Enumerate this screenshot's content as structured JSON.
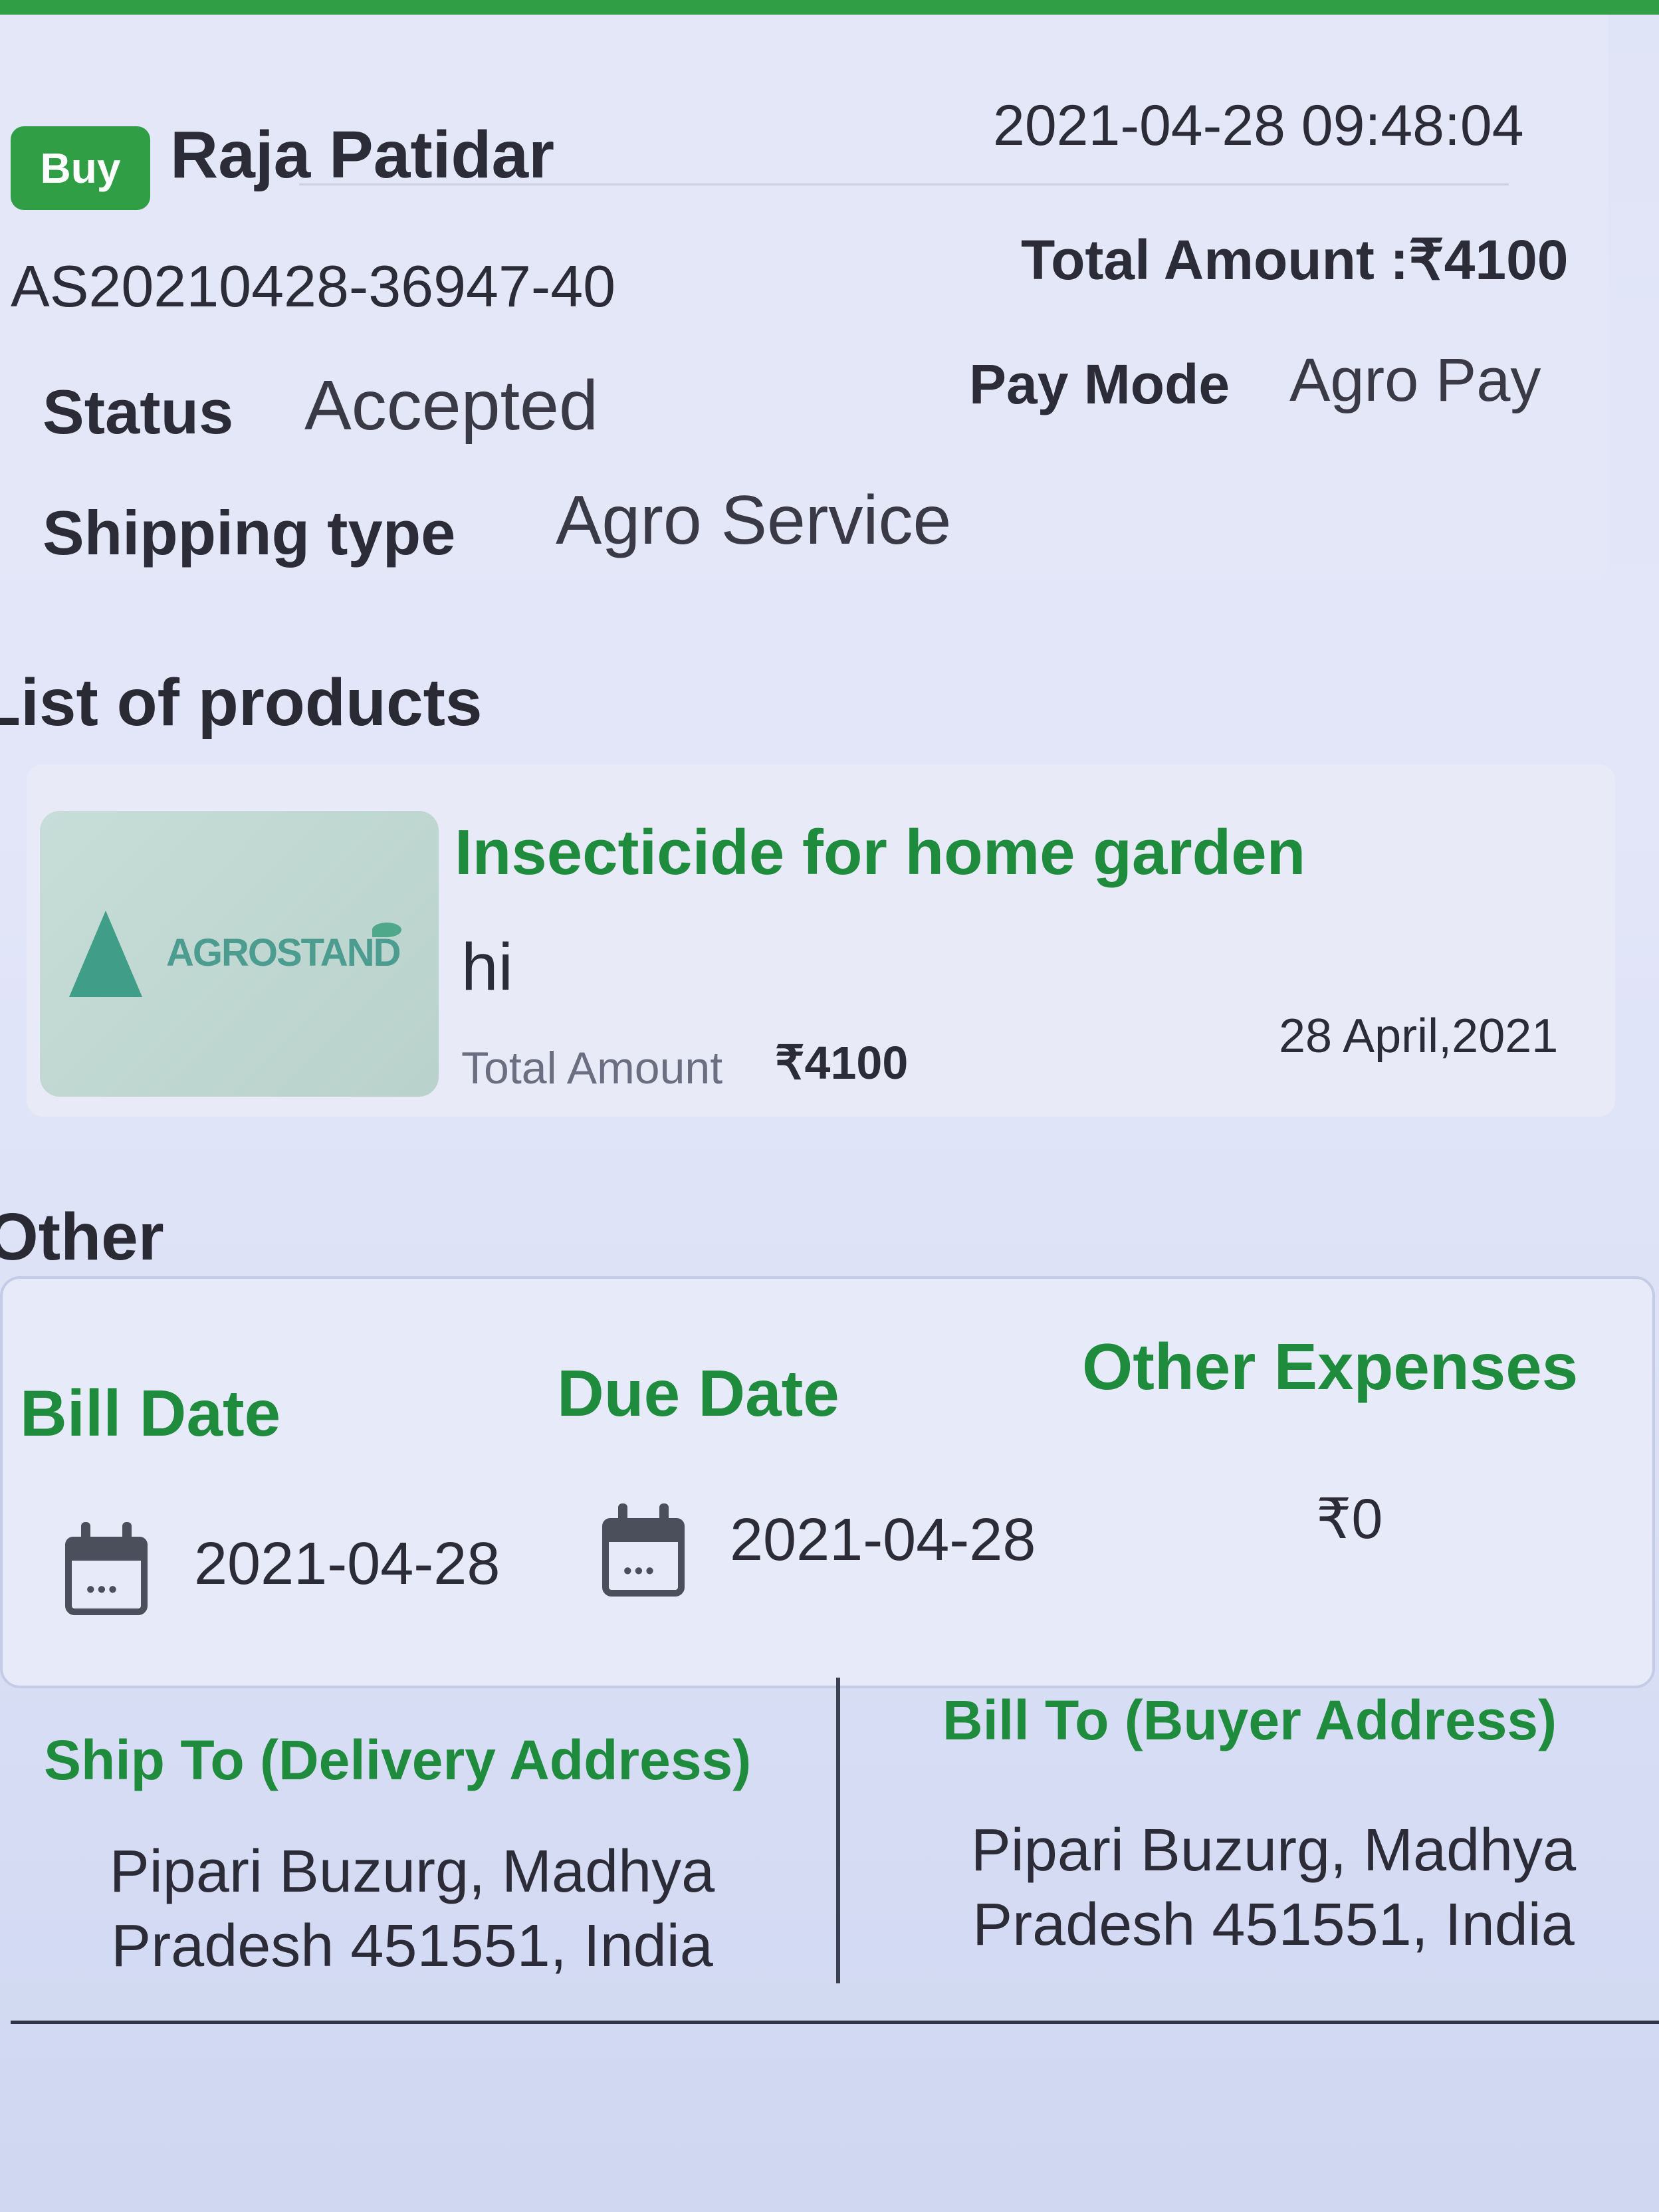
{
  "header": {
    "badge": "Buy",
    "buyer_name": "Raja Patidar",
    "datetime": "2021-04-28 09:48:04",
    "order_id": "AS20210428-36947-40",
    "total_amount": "Total Amount :₹4100",
    "status_label": "Status",
    "status_value": "Accepted",
    "pay_mode_label": "Pay Mode",
    "pay_mode_value": "Agro Pay",
    "shipping_label": "Shipping type",
    "shipping_value": "Agro Service"
  },
  "products": {
    "section_title": "List of products",
    "items": [
      {
        "logo_text": "AGROSTAND",
        "name": "Insecticide for home garden",
        "description": "hi",
        "amount_label": "Total Amount",
        "amount_value": "₹4100",
        "date": "28 April,2021"
      }
    ]
  },
  "other": {
    "section_title": "Other",
    "bill_date_label": "Bill Date",
    "bill_date_value": "2021-04-28",
    "due_date_label": "Due Date",
    "due_date_value": "2021-04-28",
    "other_expenses_label": "Other Expenses",
    "other_expenses_value": "₹0"
  },
  "addresses": {
    "ship_to_label": "Ship To (Delivery Address)",
    "ship_to_value": "Pipari Buzurg, Madhya Pradesh 451551, India",
    "bill_to_label": "Bill To (Buyer Address)",
    "bill_to_value": "Pipari Buzurg, Madhya Pradesh 451551, India"
  },
  "colors": {
    "accent_green": "#1f8b3c",
    "badge_green": "#2f9e44",
    "background": "#e3e6f8"
  },
  "icons": {
    "calendar": "calendar-icon",
    "logo": "agrostand-logo"
  }
}
